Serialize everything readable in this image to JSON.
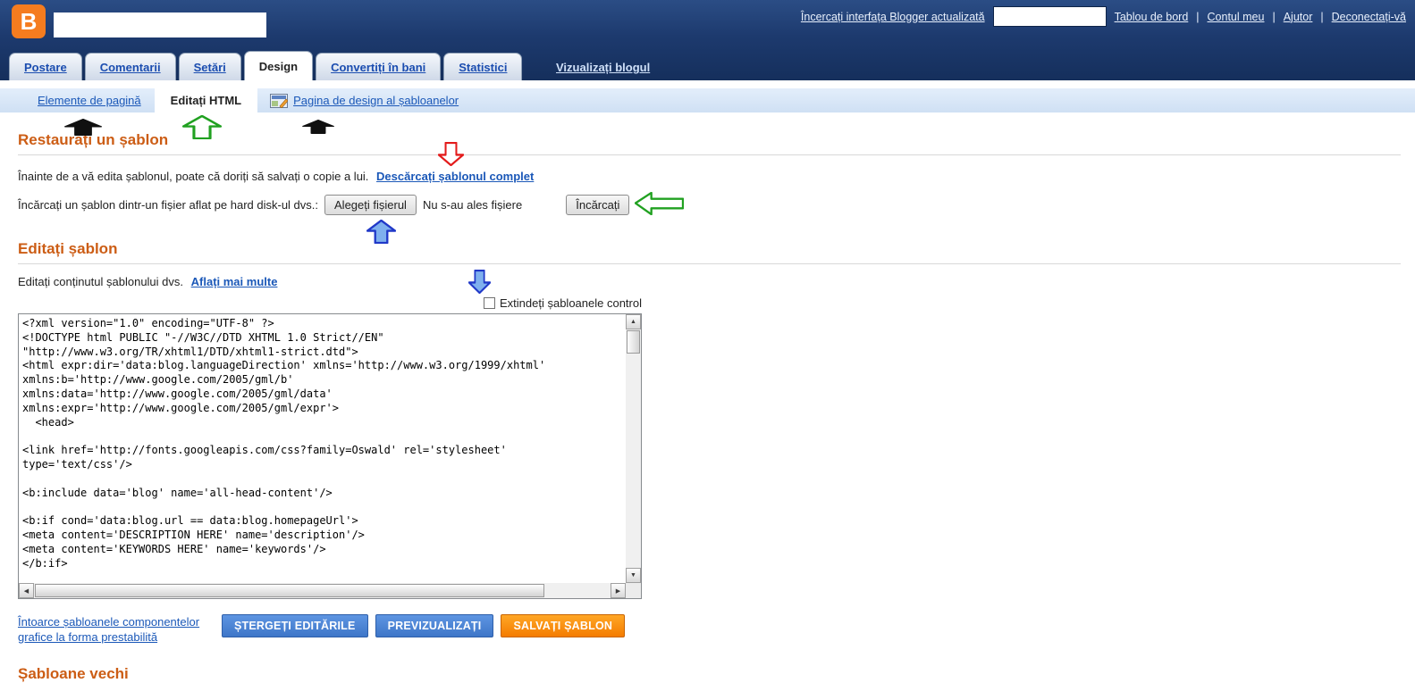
{
  "header": {
    "logo_letter": "B",
    "try_new_link": "Încercați interfața Blogger actualizată",
    "separator": "|",
    "nav": [
      "Tablou de bord",
      "Contul meu",
      "Ajutor",
      "Deconectați-vă"
    ]
  },
  "tabs": {
    "items": [
      {
        "label": "Postare",
        "active": false
      },
      {
        "label": "Comentarii",
        "active": false
      },
      {
        "label": "Setări",
        "active": false
      },
      {
        "label": "Design",
        "active": true
      },
      {
        "label": "Convertiți în bani",
        "active": false
      },
      {
        "label": "Statistici",
        "active": false
      }
    ],
    "view_blog_link": "Vizualizați blogul"
  },
  "subnav": {
    "page_elements": "Elemente de pagină",
    "edit_html": "Editați HTML",
    "template_designer": "Pagina de design al șabloanelor"
  },
  "restore_section": {
    "title": "Restaurați un șablon",
    "intro": "Înainte de a vă edita șablonul, poate că doriți să salvați o copie a lui.",
    "download_link": "Descărcați șablonul complet",
    "upload_label": "Încărcați un șablon dintr-un fișier aflat pe hard disk-ul dvs.:",
    "choose_file_button": "Alegeți fișierul",
    "no_file_text": "Nu s-au ales fișiere",
    "upload_button": "Încărcați"
  },
  "edit_section": {
    "title": "Editați șablon",
    "intro": "Editați conținutul șablonului dvs.",
    "learn_more_link": "Aflați mai multe",
    "expand_checkbox_label": "Extindeți șabloanele control",
    "expand_checkbox_checked": false,
    "code_lines": [
      "<?xml version=\"1.0\" encoding=\"UTF-8\" ?>",
      "<!DOCTYPE html PUBLIC \"-//W3C//DTD XHTML 1.0 Strict//EN\"",
      "\"http://www.w3.org/TR/xhtml1/DTD/xhtml1-strict.dtd\">",
      "<html expr:dir='data:blog.languageDirection' xmlns='http://www.w3.org/1999/xhtml'",
      "xmlns:b='http://www.google.com/2005/gml/b'",
      "xmlns:data='http://www.google.com/2005/gml/data'",
      "xmlns:expr='http://www.google.com/2005/gml/expr'>",
      "  <head>",
      "",
      "<link href='http://fonts.googleapis.com/css?family=Oswald' rel='stylesheet'",
      "type='text/css'/>",
      "",
      "<b:include data='blog' name='all-head-content'/>",
      "",
      "<b:if cond='data:blog.url == data:blog.homepageUrl'>",
      "<meta content='DESCRIPTION HERE' name='description'/>",
      "<meta content='KEYWORDS HERE' name='keywords'/>",
      "</b:if>"
    ],
    "revert_link_line1": "Întoarce șabloanele componentelor",
    "revert_link_line2": "grafice la forma prestabilită",
    "clear_edits_button": "ȘTERGEȚI EDITĂRILE",
    "preview_button": "PREVIZUALIZAȚI",
    "save_button": "SALVAȚI ȘABLON"
  },
  "old_templates_section": {
    "title": "Șabloane vechi"
  },
  "icons": {
    "scroll_up": "▲",
    "scroll_down": "▼",
    "scroll_left": "◀",
    "scroll_right": "▶"
  },
  "colors": {
    "header_navy": "#1d3a6e",
    "subnav_blue": "#d9e7f8",
    "heading_orange": "#cc5d15",
    "link_blue": "#1b58b8",
    "button_blue": "#4a84d8",
    "button_orange": "#f58220",
    "logo_orange": "#f57c1f"
  },
  "annotations": [
    {
      "name": "black-up-arrow-page-elements",
      "direction": "up",
      "stroke": "#101010",
      "fill": "#101010"
    },
    {
      "name": "green-up-arrow-edit-html",
      "direction": "up",
      "stroke": "#21a121",
      "fill": "#ffffff"
    },
    {
      "name": "black-up-arrow-template-designer",
      "direction": "up",
      "stroke": "#101010",
      "fill": "#101010"
    },
    {
      "name": "red-down-arrow-download",
      "direction": "down",
      "stroke": "#e31b1b",
      "fill": "#ffffff"
    },
    {
      "name": "green-left-arrow-upload",
      "direction": "left",
      "stroke": "#21a121",
      "fill": "#ffffff"
    },
    {
      "name": "blue-up-arrow-choose-file",
      "direction": "up",
      "stroke": "#2038c8",
      "fill": "#7fb0ee"
    },
    {
      "name": "blue-down-arrow-expand",
      "direction": "down",
      "stroke": "#2038c8",
      "fill": "#7fb0ee"
    }
  ]
}
